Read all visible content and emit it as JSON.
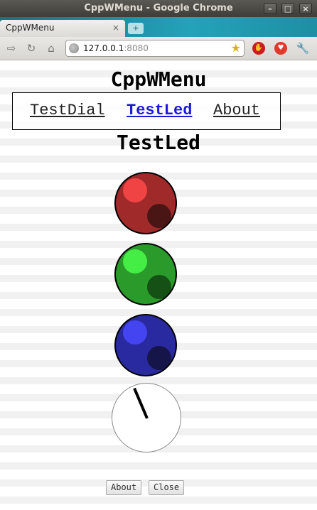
{
  "window": {
    "title": "CppWMenu - Google Chrome"
  },
  "browser": {
    "tab_title": "CppWMenu",
    "tab_close": "×",
    "new_tab": "+",
    "url_host": "127.0.0.1",
    "url_port": ":8080"
  },
  "page": {
    "app_title": "CppWMenu",
    "menu": [
      {
        "label": "TestDial",
        "active": false
      },
      {
        "label": "TestLed",
        "active": true
      },
      {
        "label": "About",
        "active": false
      }
    ],
    "section_title": "TestLed",
    "leds": [
      {
        "color_name": "red",
        "base": "#a02a2a",
        "highlight": "#f04444",
        "shadow": "#4a1515"
      },
      {
        "color_name": "green",
        "base": "#2a9a2a",
        "highlight": "#44ee44",
        "shadow": "#155015"
      },
      {
        "color_name": "blue",
        "base": "#2a2aa0",
        "highlight": "#4444f0",
        "shadow": "#15154a"
      }
    ],
    "dial": {
      "needle_angle_deg": -23
    },
    "buttons": {
      "about": "About",
      "close": "Close"
    }
  }
}
